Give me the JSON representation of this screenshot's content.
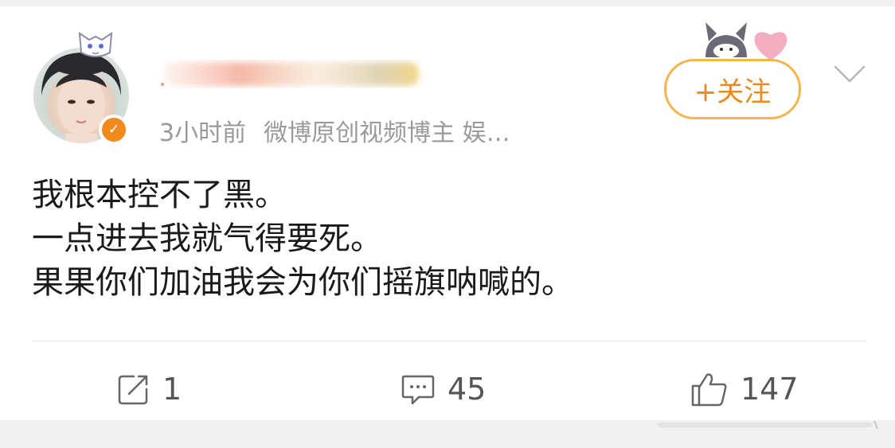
{
  "post": {
    "meta_time": "3小时前",
    "meta_source": "微博原创视频博主 娱…",
    "follow_label": "+关注",
    "lines": [
      "我根本控不了黑。",
      "一点进去我就气得要死。",
      "果果你们加油我会为你们摇旗呐喊的。"
    ]
  },
  "actions": {
    "repost_count": "1",
    "comment_count": "45",
    "like_count": "147"
  },
  "colors": {
    "accent": "#ee8a17",
    "follow_border": "#f5b54d",
    "meta_text": "#9a9a9a",
    "verified_badge": "#f08a1c"
  },
  "icons": {
    "verified": "verified-v-icon",
    "repost": "repost-icon",
    "comment": "comment-icon",
    "like": "thumbs-up-icon",
    "menu": "chevron-down-icon"
  }
}
